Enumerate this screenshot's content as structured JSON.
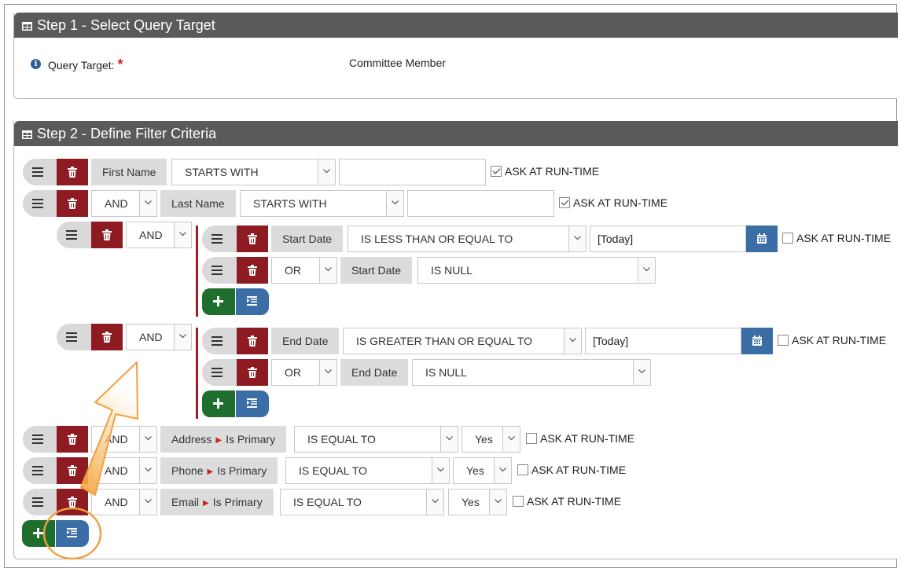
{
  "step1": {
    "title": "Step 1 - Select Query Target",
    "query_target_label": "Query Target:",
    "required_mark": "*",
    "query_target_value": "Committee Member"
  },
  "step2": {
    "title": "Step 2 - Define Filter Criteria",
    "rows": {
      "r1": {
        "field": "First Name",
        "operator": "STARTS WITH",
        "value": "",
        "ask": "ASK AT RUN-TIME",
        "ask_checked": true
      },
      "r2": {
        "conj": "AND",
        "field": "Last Name",
        "operator": "STARTS WITH",
        "value": "",
        "ask": "ASK AT RUN-TIME",
        "ask_checked": true
      },
      "g1": {
        "conj": "AND",
        "r1": {
          "field": "Start Date",
          "operator": "IS LESS THAN OR EQUAL TO",
          "value": "[Today]",
          "ask": "ASK AT RUN-TIME",
          "ask_checked": false
        },
        "r2": {
          "conj": "OR",
          "field": "Start Date",
          "operator": "IS NULL"
        }
      },
      "g2": {
        "conj": "AND",
        "r1": {
          "field": "End Date",
          "operator": "IS GREATER THAN OR EQUAL TO",
          "value": "[Today]",
          "ask": "ASK AT RUN-TIME",
          "ask_checked": false
        },
        "r2": {
          "conj": "OR",
          "field": "End Date",
          "operator": "IS NULL"
        }
      },
      "r3": {
        "conj": "AND",
        "field_parent": "Address",
        "field_child": "Is Primary",
        "operator": "IS EQUAL TO",
        "value": "Yes",
        "ask": "ASK AT RUN-TIME",
        "ask_checked": false
      },
      "r4": {
        "conj": "AND",
        "field_parent": "Phone",
        "field_child": "Is Primary",
        "operator": "IS EQUAL TO",
        "value": "Yes",
        "ask": "ASK AT RUN-TIME",
        "ask_checked": false
      },
      "r5": {
        "conj": "AND",
        "field_parent": "Email",
        "field_child": "Is Primary",
        "operator": "IS EQUAL TO",
        "value": "Yes",
        "ask": "ASK AT RUN-TIME",
        "ask_checked": false
      }
    }
  },
  "icons": {
    "panel": "table-icon",
    "handle": "drag-handle-icon",
    "delete": "trash-icon",
    "calendar": "calendar-icon",
    "add": "plus-icon",
    "indent": "indent-icon",
    "info": "info-icon"
  },
  "colors": {
    "header": "#5a5a5a",
    "delete": "#8e1b21",
    "add": "#1e6e2d",
    "blue": "#3a6ea5",
    "required": "#d61f26",
    "annotation": "#f0a040"
  }
}
